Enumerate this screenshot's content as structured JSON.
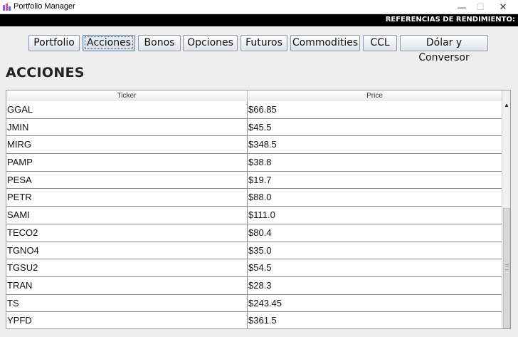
{
  "window": {
    "title": "Portfolio Manager",
    "minimize_glyph": "—",
    "maximize_glyph": "☐",
    "close_glyph": "✕"
  },
  "reference_bar": {
    "label": "REFERENCIAS DE RENDIMIENTO:"
  },
  "nav": {
    "buttons": [
      "Portfolio",
      "Acciones",
      "Bonos",
      "Opciones",
      "Futuros",
      "Commodities",
      "CCL",
      "Dólar y Conversor"
    ],
    "active": "Acciones"
  },
  "section": {
    "title": "ACCIONES"
  },
  "table": {
    "columns": [
      "Ticker",
      "Price"
    ],
    "rows": [
      [
        "GGAL",
        "$66.85"
      ],
      [
        "JMIN",
        "$45.5"
      ],
      [
        "MIRG",
        "$348.5"
      ],
      [
        "PAMP",
        "$38.8"
      ],
      [
        "PESA",
        "$19.7"
      ],
      [
        "PETR",
        "$88.0"
      ],
      [
        "SAMI",
        "$111.0"
      ],
      [
        "TECO2",
        "$80.4"
      ],
      [
        "TGNO4",
        "$35.0"
      ],
      [
        "TGSU2",
        "$54.5"
      ],
      [
        "TRAN",
        "$28.3"
      ],
      [
        "TS",
        "$243.45"
      ],
      [
        "YPFD",
        "$361.5"
      ]
    ],
    "scroll_up_glyph": "▲"
  },
  "colors": {
    "reference_bar_bg": "#000000",
    "active_border": "#5b7fb3"
  }
}
